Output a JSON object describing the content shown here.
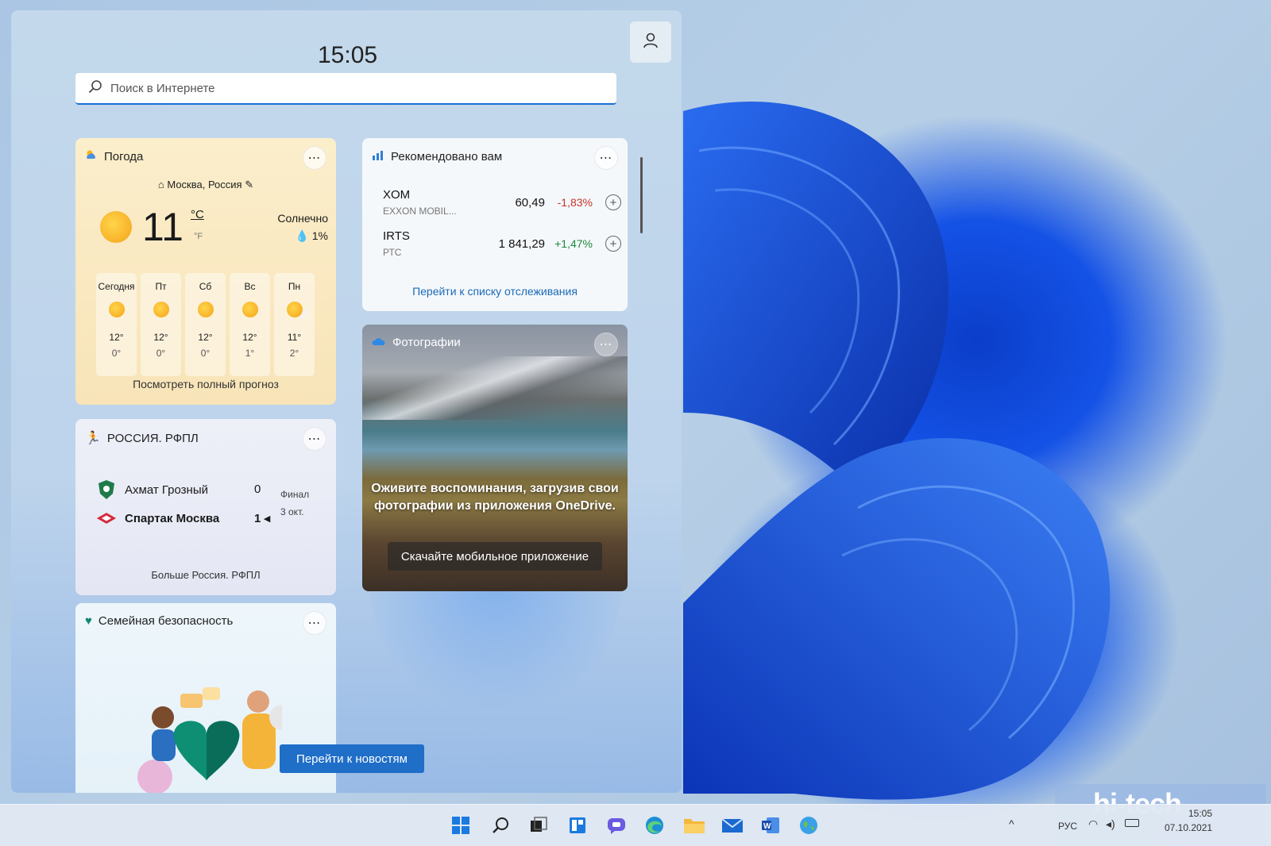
{
  "clock": "15:05",
  "search": {
    "placeholder": "Поиск в Интернете"
  },
  "weather": {
    "title": "Погода",
    "location": "Москва, Россия",
    "temp": "11",
    "unit_c": "°C",
    "unit_f": "°F",
    "condition": "Солнечно",
    "precip": "1%",
    "days": [
      {
        "label": "Сегодня",
        "hi": "12°",
        "lo": "0°",
        "icon": "sun-icon"
      },
      {
        "label": "Пт",
        "hi": "12°",
        "lo": "0°",
        "icon": "sun-icon"
      },
      {
        "label": "Сб",
        "hi": "12°",
        "lo": "0°",
        "icon": "sun-icon"
      },
      {
        "label": "Вс",
        "hi": "12°",
        "lo": "1°",
        "icon": "sun-icon"
      },
      {
        "label": "Пн",
        "hi": "11°",
        "lo": "2°",
        "icon": "partly-cloudy-icon"
      }
    ],
    "link": "Посмотреть полный прогноз"
  },
  "stocks": {
    "title": "Рекомендовано вам",
    "rows": [
      {
        "ticker": "XOM",
        "name": "EXXON MOBIL...",
        "price": "60,49",
        "change": "-1,83%"
      },
      {
        "ticker": "IRTS",
        "name": "РТС",
        "price": "1 841,29",
        "change": "+1,47%"
      }
    ],
    "link": "Перейти к списку отслеживания"
  },
  "photos": {
    "title": "Фотографии",
    "message": "Оживите воспоминания, загрузив свои фотографии из приложения OneDrive.",
    "button": "Скачайте мобильное приложение"
  },
  "sport": {
    "title": "РОССИЯ. РФПЛ",
    "team1": {
      "name": "Ахмат Грозный",
      "score": "0"
    },
    "team2": {
      "name": "Спартак Москва",
      "score": "1"
    },
    "status": "Финал",
    "date": "3 окт.",
    "link": "Больше Россия. РФПЛ"
  },
  "family": {
    "title": "Семейная безопасность"
  },
  "news_button": "Перейти к новостям",
  "tray": {
    "lang": "РУС",
    "time": "15:05",
    "date": "07.10.2021"
  },
  "watermark": "hi-tech",
  "colors": {
    "accent": "#1f6ec8",
    "negative": "#c4322b",
    "positive": "#1c8a3d"
  }
}
